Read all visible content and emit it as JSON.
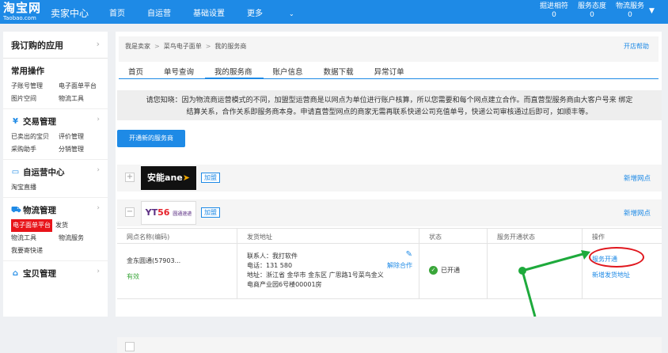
{
  "header": {
    "logo_brand": "淘宝网",
    "logo_sub": "Taobao.com",
    "center_title": "卖家中心",
    "nav": [
      "首页",
      "自运营",
      "基础设置",
      "更多"
    ],
    "stats": [
      {
        "label": "掘进相符",
        "value": "0"
      },
      {
        "label": "服务态度",
        "value": "0"
      },
      {
        "label": "物流服务",
        "value": "0"
      }
    ]
  },
  "sidebar": {
    "head": "我订购的应用",
    "sections": [
      {
        "title": "常用操作",
        "links": [
          "子账号管理",
          "电子面单平台",
          "图片空间",
          "物流工具"
        ]
      },
      {
        "title": "交易管理",
        "links": [
          "已卖出的宝贝",
          "评价管理",
          "采购助手",
          "分销管理"
        ]
      },
      {
        "title": "自运营中心",
        "links": [
          "淘宝直播"
        ]
      },
      {
        "title": "物流管理",
        "links": [
          "电子面单平台",
          "发货",
          "物流工具",
          "物流服务",
          "我要寄快递"
        ]
      },
      {
        "title": "宝贝管理",
        "links": []
      }
    ]
  },
  "breadcrumb": {
    "items": [
      "我是卖家",
      "菜鸟电子面单",
      "我的服务商"
    ],
    "help": "开店帮助"
  },
  "tabs": [
    "首页",
    "单号查询",
    "我的服务商",
    "账户信息",
    "数据下载",
    "异常订单"
  ],
  "active_tab": "我的服务商",
  "notice": {
    "line1": "请您知晓：因为物流商运营模式的不同，加盟型运营商是以网点为单位进行账户核算，所以您需要和每个网点建立合作。而直营型服务商由大客户号来 绑定",
    "line2": "结算关系，合作关系即服务商本身。申请直营型网点的商家无需再联系快递公司充值单号，快递公司审核通过后即可，如顺丰等。"
  },
  "open_button": "开通新的服务商",
  "providers": [
    {
      "logo_text": "安能",
      "logo_text2": "ane",
      "tag": "加盟",
      "add_network": "新增网点",
      "toggle": "+"
    },
    {
      "logo_text": "YT",
      "logo_text2": "56",
      "logo_small": "圆通速递",
      "tag": "加盟",
      "add_network": "新增网点",
      "toggle": "−"
    }
  ],
  "table": {
    "headers": [
      "网点名称(编码)",
      "发货地址",
      "状态",
      "服务开通状态",
      "操作"
    ],
    "row": {
      "name": "金东圆通(57903...",
      "validity": "有效",
      "contact": "联系人：我打软件",
      "phone": "电话：131      580",
      "address1": "地址：浙江省 金华市 金东区 广思路1号菜鸟金义",
      "address2": "电商产业园6号楼00001房",
      "unbind": "解除合作",
      "status": "已开通",
      "op1": "服务开通",
      "op2": "新增发货地址"
    }
  },
  "colors": {
    "primary": "#1e8ae6",
    "highlight_red": "#e8141a",
    "annotation_green": "#1eaa3c"
  }
}
